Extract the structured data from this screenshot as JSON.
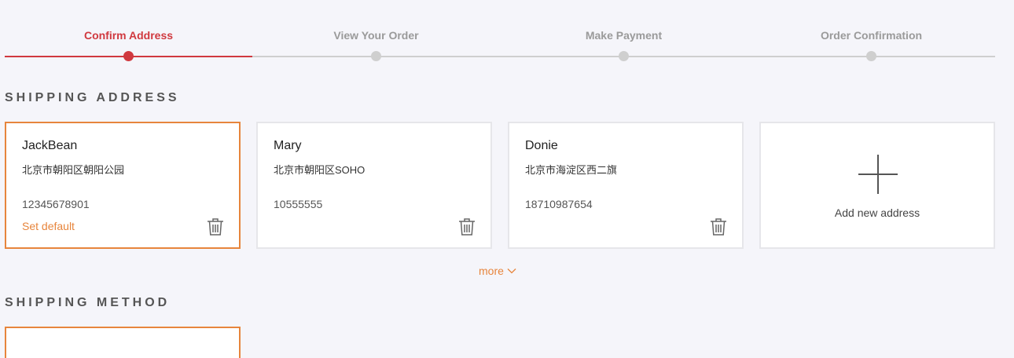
{
  "stepper": {
    "steps": [
      {
        "label": "Confirm Address",
        "active": true
      },
      {
        "label": "View Your Order",
        "active": false
      },
      {
        "label": "Make Payment",
        "active": false
      },
      {
        "label": "Order Confirmation",
        "active": false
      }
    ],
    "progress_fraction": 0.25,
    "colors": {
      "active": "#d0393f",
      "inactive": "#cfcfcf"
    }
  },
  "shipping_address": {
    "title": "SHIPPING ADDRESS",
    "cards": [
      {
        "name": "JackBean",
        "address": "北京市朝阳区朝阳公园",
        "phone": "12345678901",
        "set_default": "Set default",
        "selected": true,
        "delete_icon": "trash-icon"
      },
      {
        "name": "Mary",
        "address": "北京市朝阳区SOHO",
        "phone": "10555555",
        "selected": false,
        "delete_icon": "trash-icon"
      },
      {
        "name": "Donie",
        "address": "北京市海淀区西二旗",
        "phone": "18710987654",
        "selected": false,
        "delete_icon": "trash-icon"
      }
    ],
    "add_new": {
      "label": "Add new address",
      "icon": "plus-icon"
    },
    "more": {
      "label": "more",
      "icon": "chevron-down-icon"
    }
  },
  "shipping_method": {
    "title": "SHIPPING METHOD"
  },
  "colors": {
    "accent": "#e7853c",
    "brand_red": "#d0393f"
  }
}
